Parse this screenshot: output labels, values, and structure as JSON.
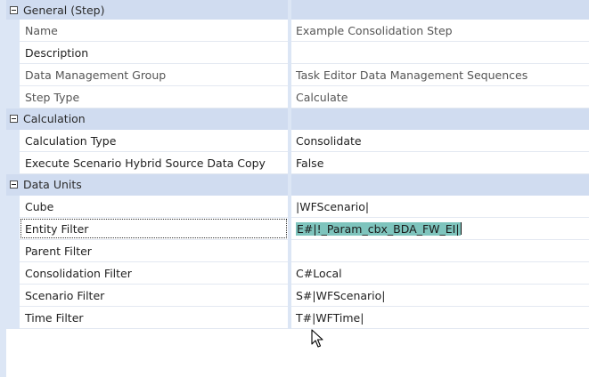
{
  "sections": [
    {
      "title": "General (Step)",
      "rows": [
        {
          "name": "Name",
          "value": "Example Consolidation Step"
        },
        {
          "name": "Description",
          "value": ""
        },
        {
          "name": "Data Management Group",
          "value": "Task Editor Data Management Sequences"
        },
        {
          "name": "Step Type",
          "value": "Calculate"
        }
      ]
    },
    {
      "title": "Calculation",
      "rows": [
        {
          "name": "Calculation Type",
          "value": "Consolidate"
        },
        {
          "name": "Execute Scenario Hybrid Source Data Copy",
          "value": "False"
        }
      ]
    },
    {
      "title": "Data Units",
      "rows": [
        {
          "name": "Cube",
          "value": "|WFScenario|"
        },
        {
          "name": "Entity Filter",
          "value": "E#|!_Param_cbx_BDA_FW_EI|"
        },
        {
          "name": "Parent Filter",
          "value": ""
        },
        {
          "name": "Consolidation Filter",
          "value": "C#Local"
        },
        {
          "name": "Scenario Filter",
          "value": "S#|WFScenario|"
        },
        {
          "name": "Time Filter",
          "value": "T#|WFTime|"
        }
      ]
    }
  ],
  "icons": {
    "collapse": "collapse-minus-icon",
    "cursor": "mouse-pointer-icon"
  },
  "colors": {
    "category_bg": "#d0dcf0",
    "gutter": "#dce6f5",
    "selection": "#7ec4bd"
  }
}
